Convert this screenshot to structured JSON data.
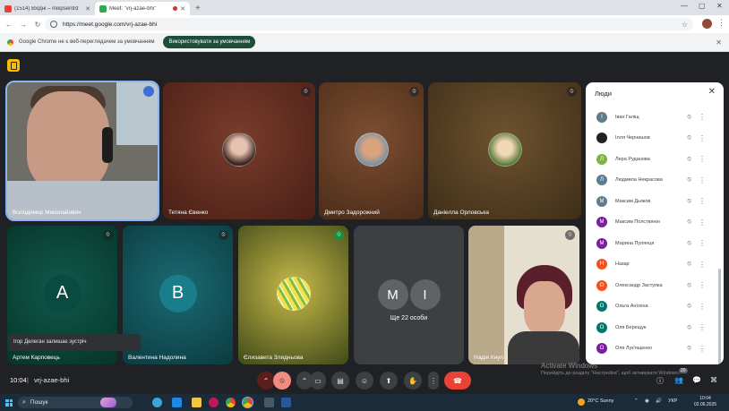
{
  "browser": {
    "tabs": [
      {
        "title": "(1514) Вхідні – mikpsentrd",
        "active": false
      },
      {
        "title": "Meet: \"vrj-azae-bhi\"",
        "active": true
      }
    ],
    "new_tab": "+",
    "url": "https://meet.google.com/vrj-azae-bhi",
    "infobar_message": "Google Chrome не є веб-переглядачем за умовчанням",
    "infobar_button": "Використовувати за умовчанням"
  },
  "meet": {
    "tiles": [
      {
        "name": "Володимир Миколайович"
      },
      {
        "name": "Тетяна Євенко"
      },
      {
        "name": "Дмитро Задорожний"
      },
      {
        "name": "Даніелла Орловська"
      },
      {
        "name": "Артем Карповець",
        "letter": "A"
      },
      {
        "name": "Валентина Надолина",
        "letter": "B"
      },
      {
        "name": "Єлизавета Злидньова"
      },
      {
        "name": "",
        "more_letters": [
          "M",
          "I"
        ],
        "more_label": "Ще 22 особи"
      },
      {
        "name": "Надія Кнуп"
      }
    ],
    "toast": "Ігор Делеган залишає зустріч",
    "people_panel": {
      "title": "Люди",
      "people": [
        {
          "letter": "І",
          "name": "Іван Галіщ",
          "color": "#5f7d8c"
        },
        {
          "letter": "",
          "name": "Ілля Чернишов",
          "color": "#202124"
        },
        {
          "letter": "Л",
          "name": "Лера Руданова",
          "color": "#7cb342"
        },
        {
          "letter": "Л",
          "name": "Людмила Некрасова",
          "color": "#5f7d8c"
        },
        {
          "letter": "М",
          "name": "Максим Дьяков",
          "color": "#5f7d8c"
        },
        {
          "letter": "М",
          "name": "Максим Полствянін",
          "color": "#7b1fa2"
        },
        {
          "letter": "М",
          "name": "Марина Пулянця",
          "color": "#7b1fa2"
        },
        {
          "letter": "Н",
          "name": "Назар",
          "color": "#f4511e"
        },
        {
          "letter": "О",
          "name": "Олександр Заступка",
          "color": "#f4511e"
        },
        {
          "letter": "О",
          "name": "Ольга Анохіна",
          "color": "#00796b"
        },
        {
          "letter": "О",
          "name": "Оля Берещук",
          "color": "#00796b"
        },
        {
          "letter": "О",
          "name": "Оля Лук'ященко",
          "color": "#7b1fa2"
        }
      ]
    },
    "time": "10:04",
    "meeting_code": "vrj-azae-bhi"
  },
  "windows": {
    "watermark_title": "Activate Windows",
    "watermark_sub": "Перейдіть до розділу \"Настройки\", щоб активувати Windows.",
    "search_placeholder": "Пошук",
    "weather": "20°C  Sunny",
    "language": "УКР",
    "clock_time": "10:04",
    "clock_date": "02.06.2025",
    "notification_count": "20"
  },
  "colors": {
    "accent_blue": "#8ab4f8",
    "end_call_red": "#ea4335",
    "meet_dark": "#202124"
  }
}
